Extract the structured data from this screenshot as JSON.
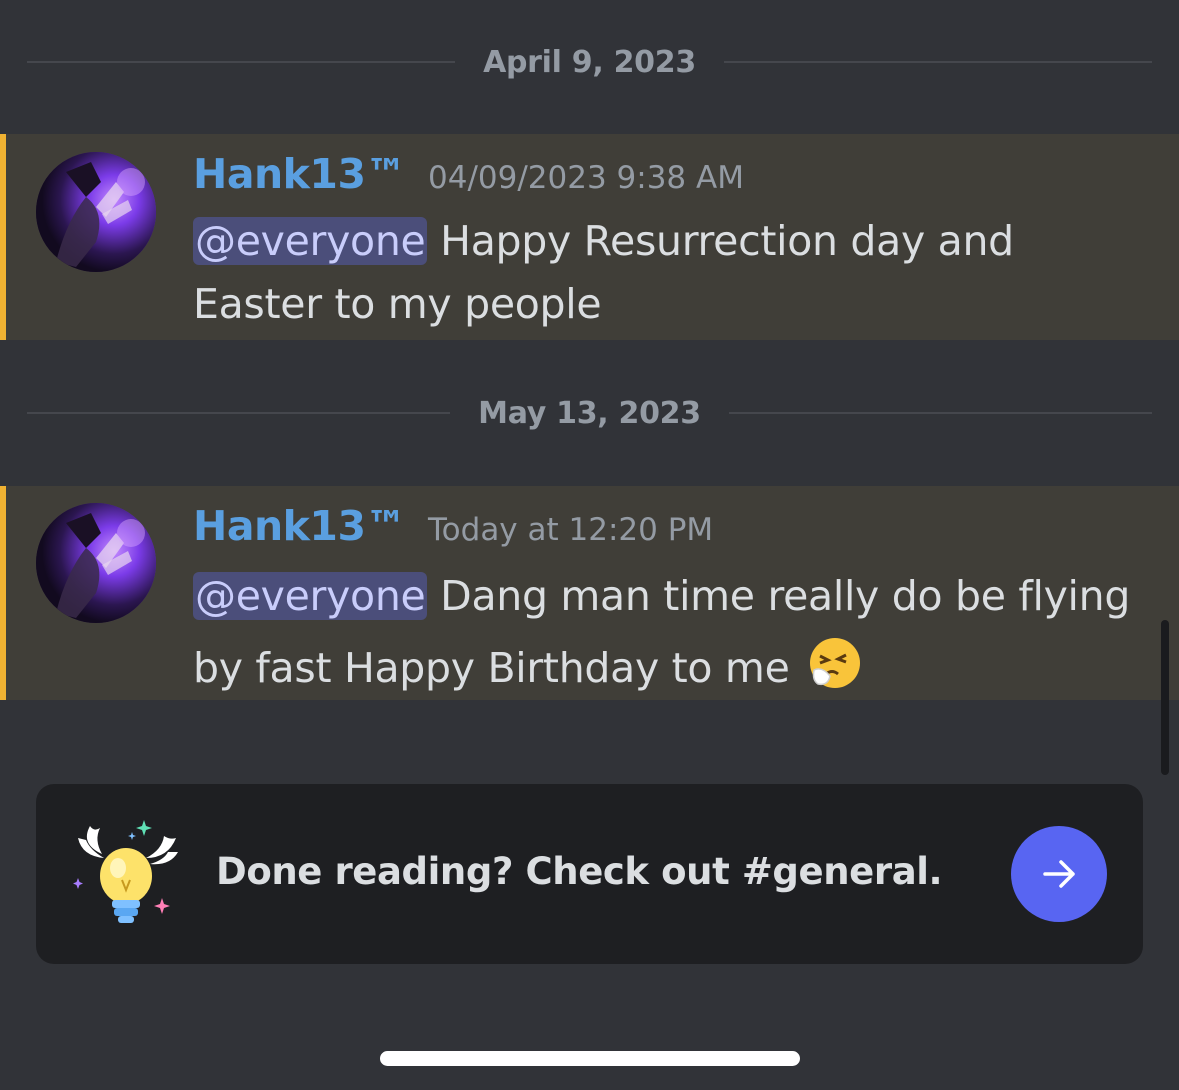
{
  "divider_1": {
    "date": "April 9, 2023"
  },
  "message_1": {
    "username": "Hank13™",
    "timestamp": "04/09/2023 9:38 AM",
    "mention": "@everyone",
    "text_line1": " Happy Resurrection day and",
    "text_line2": "Easter to my people"
  },
  "divider_2": {
    "date": "May 13, 2023"
  },
  "message_2": {
    "username": "Hank13™",
    "timestamp": "Today at 12:20 PM",
    "mention": "@everyone",
    "text_line1": " Dang man time really do be flying",
    "text_line2": "by fast Happy Birthday to me",
    "emoji": "sneezing-face"
  },
  "prompt": {
    "text": "Done reading? Check out #general.",
    "icon": "winged-lightbulb-icon",
    "action_icon": "arrow-right-icon"
  },
  "colors": {
    "background": "#313338",
    "highlight_background": "#403e38",
    "highlight_bar": "#f0b232",
    "username": "#5a9fe0",
    "mention_bg": "#4b4e7a",
    "button": "#5865f2"
  }
}
